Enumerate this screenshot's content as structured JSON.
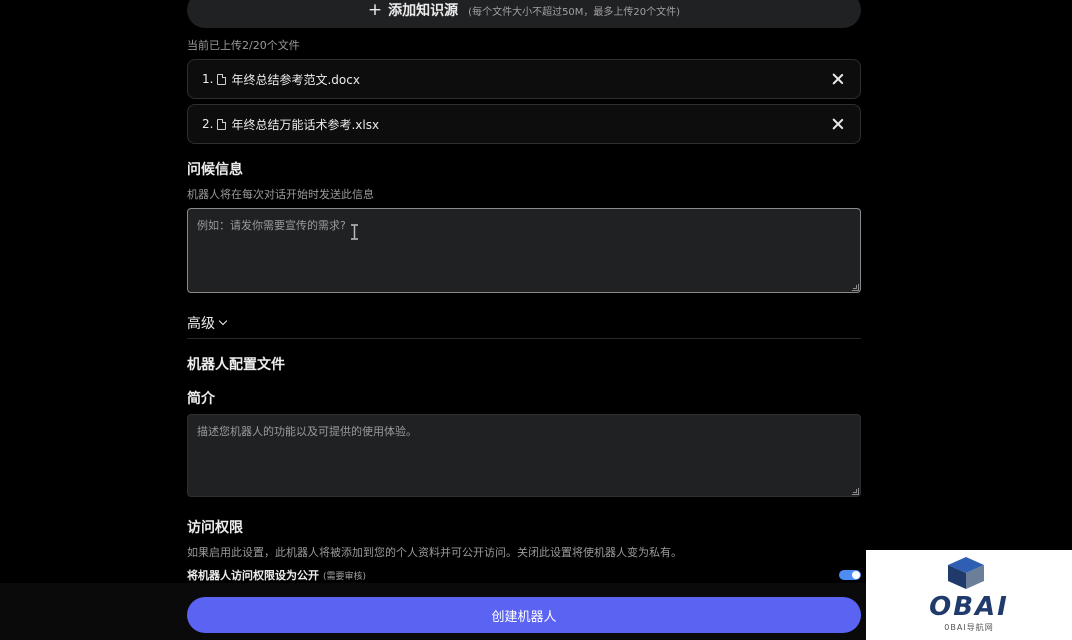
{
  "knowledge": {
    "add_label": "添加知识源",
    "add_hint": "(每个文件大小不超过50M，最多上传20个文件)",
    "upload_count": "当前已上传2/20个文件",
    "files": [
      {
        "index": "1.",
        "name": "年终总结参考范文.docx"
      },
      {
        "index": "2.",
        "name": "年终总结万能话术参考.xlsx"
      }
    ]
  },
  "greeting": {
    "title": "问候信息",
    "desc": "机器人将在每次对话开始时发送此信息",
    "placeholder": "例如：请发你需要宣传的需求?"
  },
  "advanced": {
    "label": "高级"
  },
  "profile": {
    "title": "机器人配置文件",
    "intro_title": "简介",
    "intro_placeholder": "描述您机器人的功能以及可提供的使用体验。"
  },
  "access": {
    "title": "访问权限",
    "desc": "如果启用此设置，此机器人将被添加到您的个人资料并可公开访问。关闭此设置将使机器人变为私有。",
    "toggle_label": "将机器人访问权限设为公开",
    "toggle_sub": "(需要审核)",
    "toggle_on": true
  },
  "create_button": "创建机器人",
  "watermark": {
    "brand": "OBAI",
    "sub": "0BAI导航网"
  },
  "colors": {
    "accent": "#5b63f2",
    "toggle": "#4d8cf5"
  }
}
